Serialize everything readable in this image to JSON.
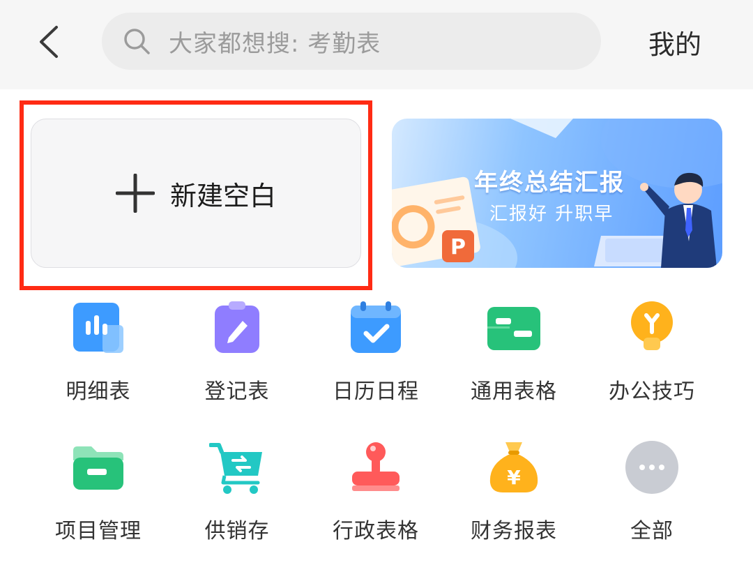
{
  "header": {
    "search_placeholder": "大家都想搜: 考勤表",
    "mine_label": "我的"
  },
  "new_blank": {
    "label": "新建空白"
  },
  "banner": {
    "title": "年终总结汇报",
    "subtitle": "汇报好 升职早",
    "badge": "P"
  },
  "categories": [
    {
      "label": "明细表",
      "icon": "bar-chart-icon"
    },
    {
      "label": "登记表",
      "icon": "clipboard-pencil-icon"
    },
    {
      "label": "日历日程",
      "icon": "calendar-check-icon"
    },
    {
      "label": "通用表格",
      "icon": "table-card-icon"
    },
    {
      "label": "办公技巧",
      "icon": "lightbulb-icon"
    },
    {
      "label": "项目管理",
      "icon": "folder-icon"
    },
    {
      "label": "供销存",
      "icon": "shopping-cart-icon"
    },
    {
      "label": "行政表格",
      "icon": "stamp-icon"
    },
    {
      "label": "财务报表",
      "icon": "money-bag-icon"
    },
    {
      "label": "全部",
      "icon": "more-icon"
    }
  ],
  "colors": {
    "highlight": "#ff2b14",
    "blue": "#3d9bff",
    "purple": "#8f7dff",
    "green": "#27c27a",
    "orange": "#ffb21c",
    "red": "#ff5a5a",
    "teal": "#22c8c4",
    "gray": "#c9ccd3"
  }
}
